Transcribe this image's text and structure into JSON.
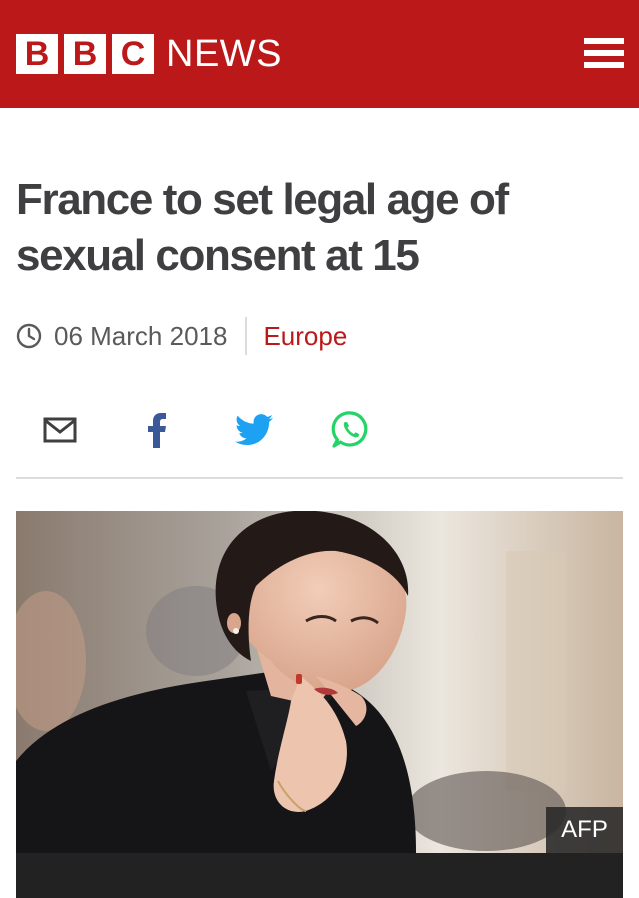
{
  "header": {
    "brand_letters": [
      "B",
      "B",
      "C"
    ],
    "brand_word": "NEWS",
    "color": "#bb1919",
    "menu_icon": "hamburger-menu-icon"
  },
  "article": {
    "headline_line1": "France to set legal age of",
    "headline_line2": "sexual consent at 15",
    "date": "06 March 2018",
    "section": "Europe",
    "section_color": "#bb1919"
  },
  "share": {
    "icons": [
      "email-icon",
      "facebook-icon",
      "twitter-icon",
      "whatsapp-icon"
    ],
    "colors": {
      "facebook": "#3b5998",
      "twitter": "#1da1f2",
      "whatsapp": "#25d366",
      "email": "#3f3f42"
    }
  },
  "image": {
    "credit": "AFP"
  }
}
